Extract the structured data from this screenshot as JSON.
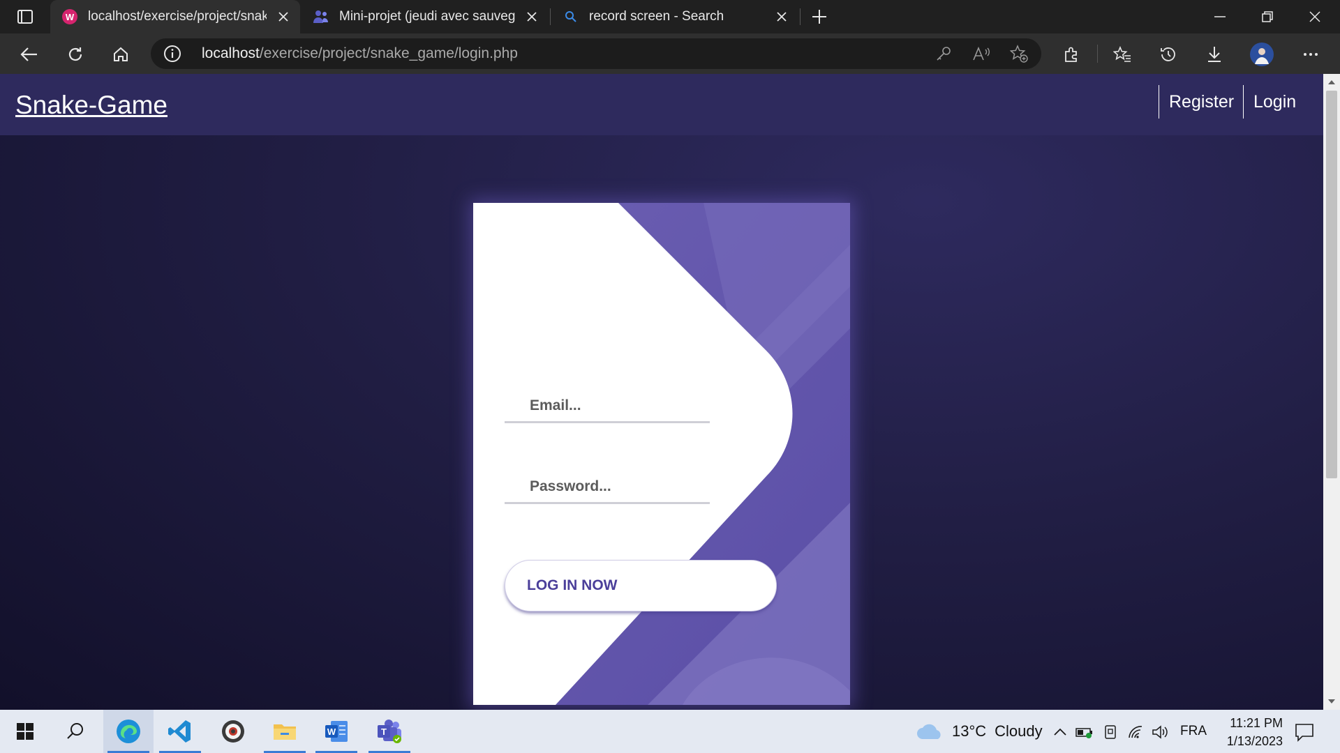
{
  "browser": {
    "tabs": [
      {
        "title": "localhost/exercise/project/snake_game/login.php",
        "icon": "php-favicon",
        "active": true
      },
      {
        "title": "Mini-projet (jeudi avec sauvegarde)",
        "icon": "teams-people-icon",
        "active": false
      },
      {
        "title": "record screen - Search",
        "icon": "search-icon",
        "active": false
      }
    ],
    "address": {
      "host": "localhost",
      "path": "/exercise/project/snake_game/login.php"
    }
  },
  "site": {
    "brand": "Snake-Game",
    "nav": {
      "register": "Register",
      "login": "Login"
    },
    "form": {
      "email_placeholder": "Email...",
      "password_placeholder": "Password...",
      "submit_label": "LOG IN NOW"
    },
    "colors": {
      "header": "#2e2a5d",
      "accent": "#6a5fb8",
      "button_text": "#4b3f9a"
    }
  },
  "taskbar": {
    "weather": {
      "temp": "13°C",
      "condition": "Cloudy"
    },
    "language": "FRA",
    "time": "11:21 PM",
    "date": "1/13/2023",
    "apps": [
      "start",
      "search",
      "edge",
      "vscode",
      "obs",
      "file-explorer",
      "word",
      "teams"
    ]
  }
}
